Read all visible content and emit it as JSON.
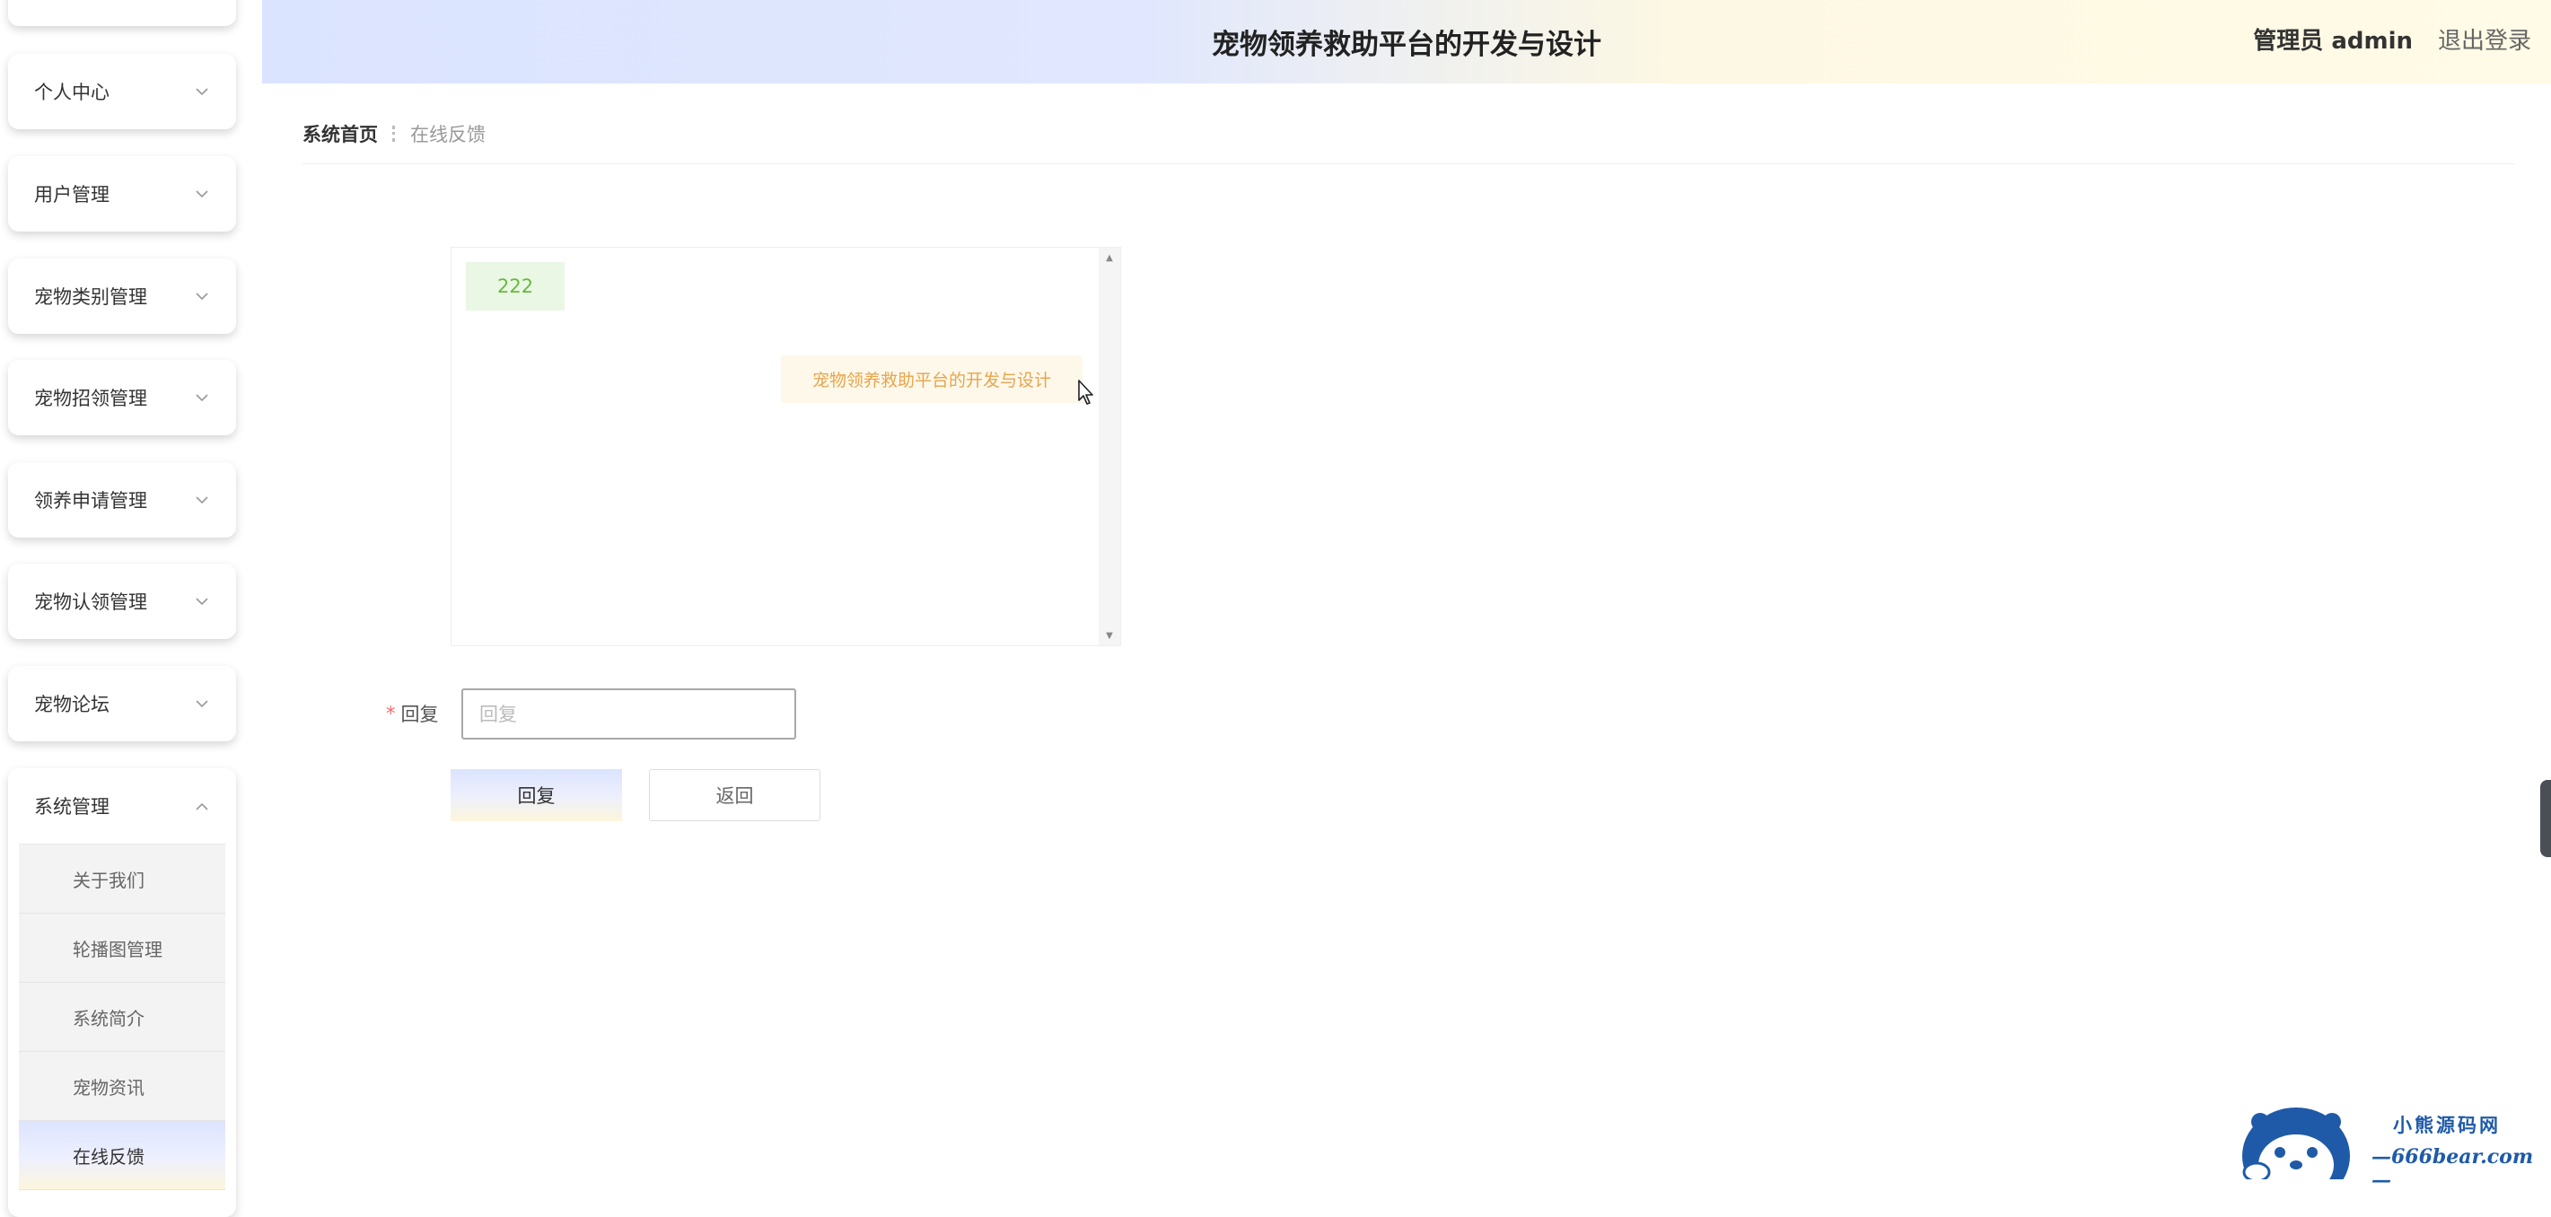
{
  "header": {
    "title": "宠物领养救助平台的开发与设计",
    "user_label": "管理员 admin",
    "logout_label": "退出登录"
  },
  "sidebar": {
    "items": [
      {
        "label": "个人中心"
      },
      {
        "label": "用户管理"
      },
      {
        "label": "宠物类别管理"
      },
      {
        "label": "宠物招领管理"
      },
      {
        "label": "领养申请管理"
      },
      {
        "label": "宠物认领管理"
      },
      {
        "label": "宠物论坛"
      },
      {
        "label": "系统管理"
      }
    ],
    "system_sub": [
      {
        "label": "关于我们"
      },
      {
        "label": "轮播图管理"
      },
      {
        "label": "系统简介"
      },
      {
        "label": "宠物资讯"
      },
      {
        "label": "在线反馈",
        "active": true
      }
    ]
  },
  "breadcrumb": {
    "home": "系统首页",
    "current": "在线反馈"
  },
  "chat": {
    "user_message": "222",
    "admin_message": "宠物领养救助平台的开发与设计"
  },
  "form": {
    "reply_label": "回复",
    "reply_placeholder": "回复",
    "reply_value": "",
    "submit_label": "回复",
    "back_label": "返回"
  },
  "watermark": {
    "title": "小熊源码网",
    "url": "—666bear.com—"
  },
  "colors": {
    "header_gradient_start": "#dbe4ff",
    "header_gradient_end": "#fffbe6",
    "user_bubble_bg": "#eaf7e4",
    "user_bubble_text": "#67b93e",
    "admin_bubble_bg": "#fdf8ea",
    "admin_bubble_text": "#e8a54c",
    "required_mark": "#f56c6c"
  },
  "icons": {
    "menu_collapsed": "chevron-down-icon",
    "menu_expanded": "chevron-up-icon",
    "scroll_up": "scroll-up-arrow-icon",
    "scroll_down": "scroll-down-arrow-icon",
    "cursor": "mouse-pointer-icon",
    "watermark_logo": "bear-mascot-icon"
  }
}
